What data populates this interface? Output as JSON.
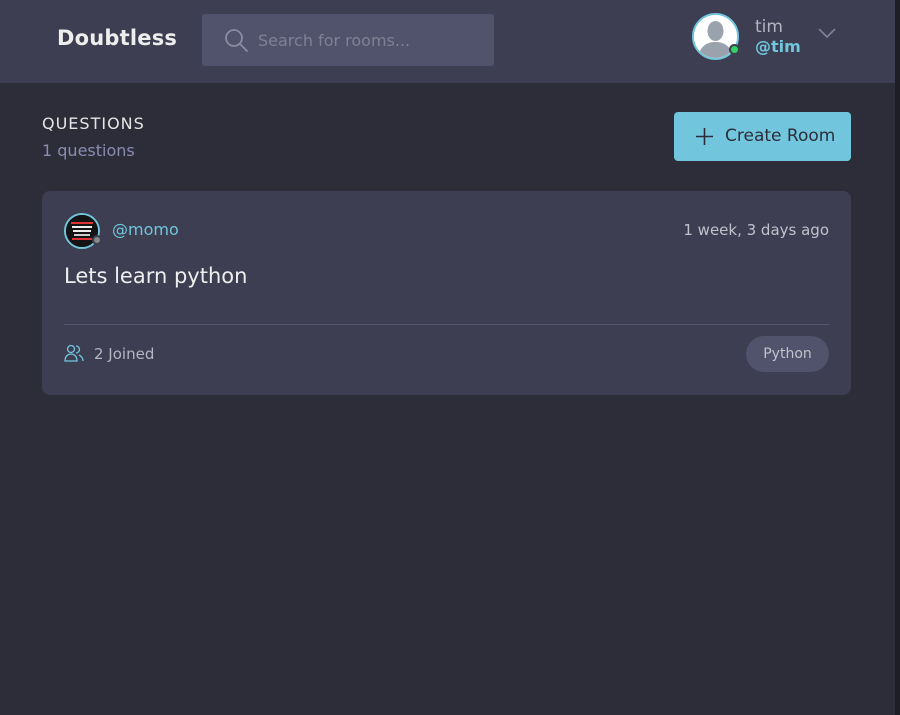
{
  "header": {
    "logo": "Doubtless",
    "search_placeholder": "Search for rooms...",
    "user": {
      "name": "tim",
      "handle": "@tim"
    }
  },
  "main": {
    "section_title": "QUESTIONS",
    "section_count": "1 questions",
    "create_button_label": "Create Room",
    "rooms": [
      {
        "host": "@momo",
        "time": "1 week, 3 days ago",
        "title": "Lets learn python",
        "joined": "2 Joined",
        "topic": "Python"
      }
    ]
  },
  "colors": {
    "background": "#2d2d39",
    "header": "#3d3e51",
    "accent": "#71c6dd",
    "online": "#2fd364"
  },
  "icons": [
    "search-icon",
    "user-avatar-icon",
    "online-status-icon",
    "chevron-down-icon",
    "plus-icon",
    "users-icon"
  ]
}
